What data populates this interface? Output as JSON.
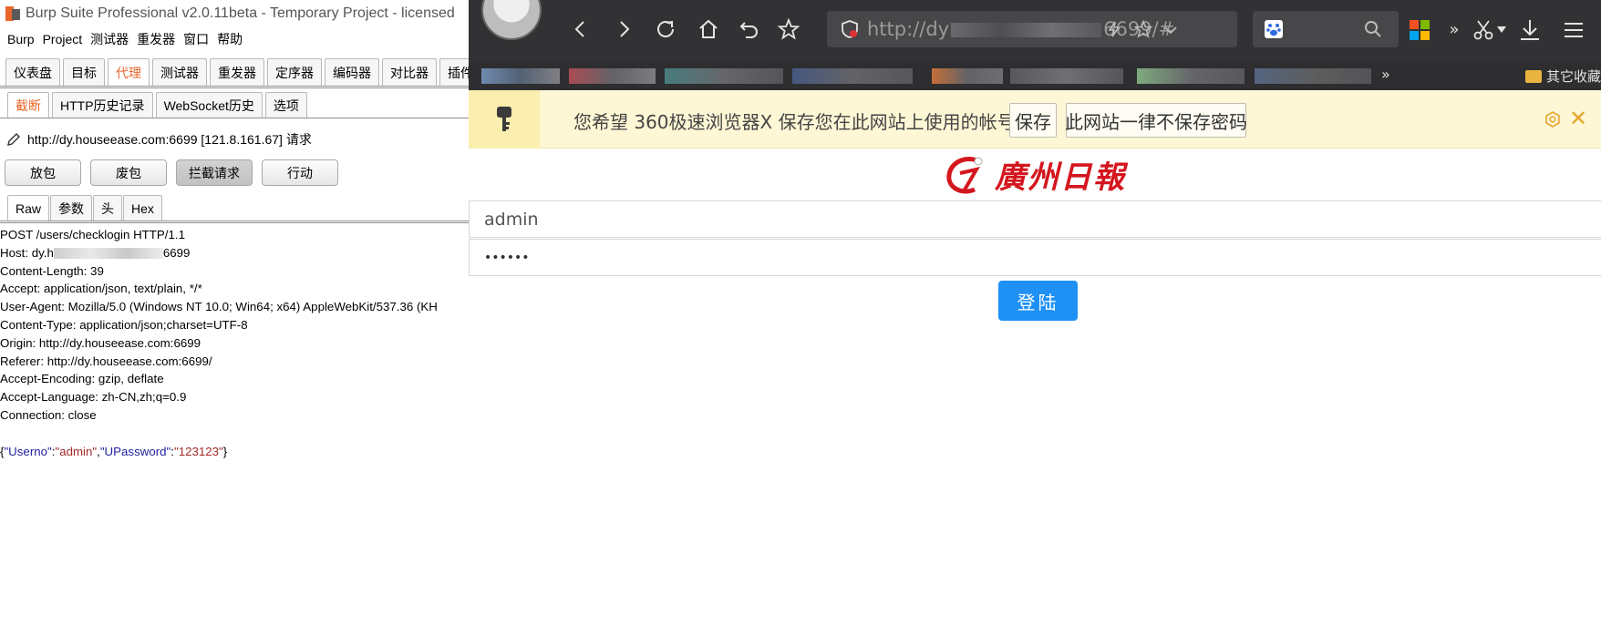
{
  "burp": {
    "title": "Burp Suite Professional v2.0.11beta - Temporary Project - licensed",
    "menu": [
      "Burp",
      "Project",
      "测试器",
      "重发器",
      "窗口",
      "帮助"
    ],
    "main_tabs": [
      "仪表盘",
      "目标",
      "代理",
      "测试器",
      "重发器",
      "定序器",
      "编码器",
      "对比器",
      "插件扩"
    ],
    "proxy_tabs": [
      "截断",
      "HTTP历史记录",
      "WebSocket历史",
      "选项"
    ],
    "request_target": "http://dy.houseease.com:6699  [121.8.161.67] 请求",
    "buttons": [
      "放包",
      "废包",
      "拦截请求",
      "行动"
    ],
    "view_tabs": [
      "Raw",
      "参数",
      "头",
      "Hex"
    ],
    "request": {
      "line1": "POST /users/checklogin HTTP/1.1",
      "host_prefix": "Host: dy.h",
      "host_suffix": "6699",
      "headers": [
        "Content-Length: 39",
        "Accept: application/json, text/plain, */*",
        "User-Agent: Mozilla/5.0 (Windows NT 10.0; Win64; x64) AppleWebKit/537.36 (KH",
        "Content-Type: application/json;charset=UTF-8",
        "Origin: http://dy.houseease.com:6699",
        "Referer: http://dy.houseease.com:6699/",
        "Accept-Encoding: gzip, deflate",
        "Accept-Language: zh-CN,zh;q=0.9",
        "Connection: close"
      ],
      "body": {
        "open": "{",
        "k1": "\"Userno\"",
        "c1": ":",
        "v1": "\"admin\"",
        "sep": ",",
        "k2": "\"UPassword\"",
        "c2": ":",
        "v2": "\"123123\"",
        "close": "}"
      }
    }
  },
  "browser": {
    "url_prefix": "http://dy",
    "url_suffix": "6699/#",
    "bookmarks_more": "»",
    "other_bookmarks": "其它收藏",
    "password_prompt": {
      "text": "您希望 360极速浏览器X 保存您在此网站上使用的帐号吗?",
      "save": "保存",
      "never": "此网站一律不保存密码"
    },
    "logo_text": "廣州日報",
    "username_value": "admin",
    "password_value": "••••••",
    "login_button": "登陆"
  },
  "colors": {
    "burp_accent": "#e8662a",
    "login_button": "#1e90f6",
    "prompt_bg": "#fef7d6",
    "logo_red": "#d4161e"
  }
}
